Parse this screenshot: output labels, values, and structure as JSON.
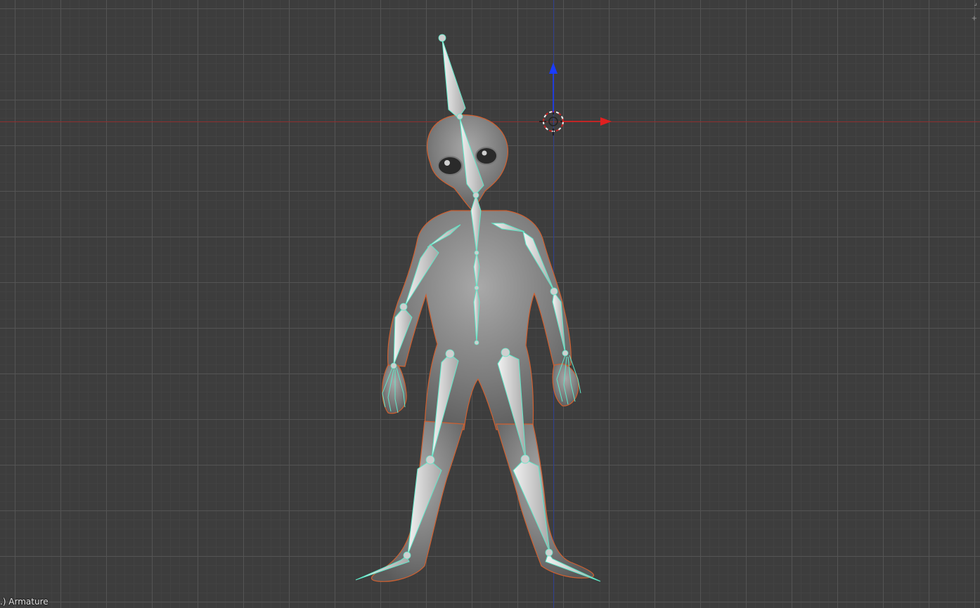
{
  "viewport": {
    "status_text": ".) Armature",
    "background_color": "#3d3d3d",
    "grid_color": "#555555",
    "x_axis_color": "#8f2f2f",
    "z_axis_color": "#2f3f8f"
  },
  "icons": {
    "cursor": "3d-cursor-icon",
    "gizmo_z": "manipulator-z-arrow-icon",
    "gizmo_x": "manipulator-x-arrow-icon",
    "corner": "area-split-corner-icon"
  },
  "colors": {
    "bone_outline": "#5fe8c8",
    "bone_fill": "#d8d8d8",
    "mesh": "#8a8a8a",
    "mesh_outline": "#d06030",
    "gizmo_z": "#1a3cff",
    "gizmo_x": "#e02020"
  }
}
